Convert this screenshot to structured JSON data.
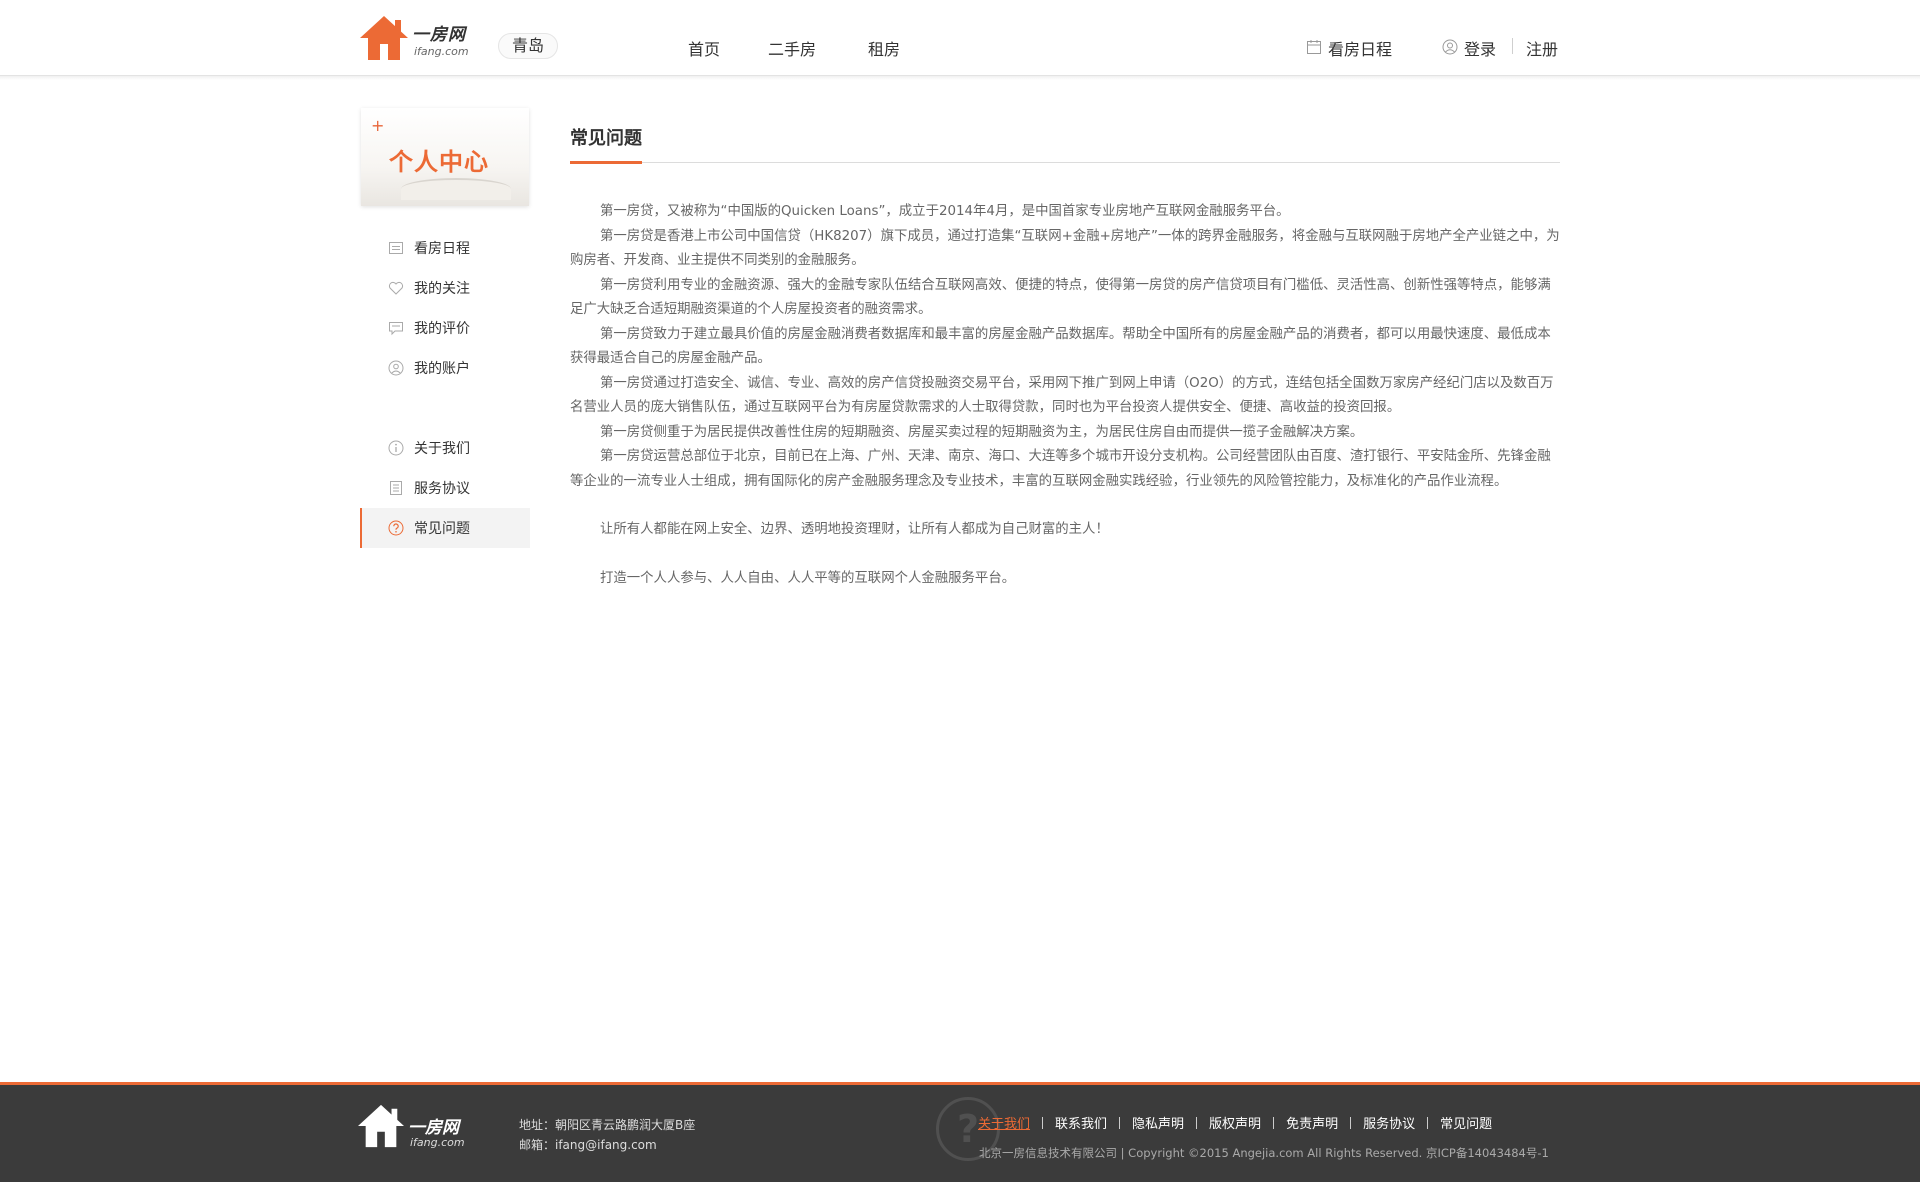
{
  "header": {
    "logo": {
      "brand": "一房网",
      "domain": "ifang.com"
    },
    "city": "青岛",
    "nav": [
      {
        "label": "首页"
      },
      {
        "label": "二手房"
      },
      {
        "label": "租房"
      }
    ],
    "schedule_label": "看房日程",
    "login_label": "登录",
    "register_label": "注册"
  },
  "sidebar": {
    "card_title": "个人中心",
    "card_plus": "+",
    "items": [
      {
        "label": "看房日程",
        "icon": "calendar-icon"
      },
      {
        "label": "我的关注",
        "icon": "heart-icon"
      },
      {
        "label": "我的评价",
        "icon": "comment-icon"
      },
      {
        "label": "我的账户",
        "icon": "user-icon"
      },
      {
        "label": "关于我们",
        "icon": "info-icon"
      },
      {
        "label": "服务协议",
        "icon": "document-icon"
      },
      {
        "label": "常见问题",
        "icon": "question-icon",
        "active": true
      }
    ]
  },
  "content": {
    "title": "常见问题",
    "paragraphs": [
      "第一房贷，又被称为“中国版的Quicken Loans”，成立于2014年4月，是中国首家专业房地产互联网金融服务平台。",
      "第一房贷是香港上市公司中国信贷（HK8207）旗下成员，通过打造集“互联网+金融+房地产”一体的跨界金融服务，将金融与互联网融于房地产全产业链之中，为购房者、开发商、业主提供不同类别的金融服务。",
      "第一房贷利用专业的金融资源、强大的金融专家队伍结合互联网高效、便捷的特点，使得第一房贷的房产信贷项目有门槛低、灵活性高、创新性强等特点，能够满足广大缺乏合适短期融资渠道的个人房屋投资者的融资需求。",
      "第一房贷致力于建立最具价值的房屋金融消费者数据库和最丰富的房屋金融产品数据库。帮助全中国所有的房屋金融产品的消费者，都可以用最快速度、最低成本获得最适合自己的房屋金融产品。",
      "第一房贷通过打造安全、诚信、专业、高效的房产信贷投融资交易平台，采用网下推广到网上申请（O2O）的方式，连结包括全国数万家房产经纪门店以及数百万名营业人员的庞大销售队伍，通过互联网平台为有房屋贷款需求的人士取得贷款，同时也为平台投资人提供安全、便捷、高收益的投资回报。",
      "第一房贷侧重于为居民提供改善性住房的短期融资、房屋买卖过程的短期融资为主，为居民住房自由而提供一揽子金融解决方案。",
      "第一房贷运营总部位于北京，目前已在上海、广州、天津、南京、海口、大连等多个城市开设分支机构。公司经营团队由百度、渣打银行、平安陆金所、先锋金融等企业的一流专业人士组成，拥有国际化的房产金融服务理念及专业技术，丰富的互联网金融实践经验，行业领先的风险管控能力，及标准化的产品作业流程。"
    ],
    "slogan1": "让所有人都能在网上安全、边界、透明地投资理财，让所有人都成为自己财富的主人！",
    "slogan2": "打造一个人人参与、人人自由、人人平等的互联网个人金融服务平台。"
  },
  "footer": {
    "logo": {
      "brand": "一房网",
      "domain": "ifang.com"
    },
    "address": "地址：朝阳区青云路鹏润大厦B座",
    "email": "邮箱：ifang@ifang.com",
    "links": [
      {
        "label": "关于我们",
        "active": true
      },
      {
        "label": "联系我们"
      },
      {
        "label": "隐私声明"
      },
      {
        "label": "版权声明"
      },
      {
        "label": "免责声明"
      },
      {
        "label": "服务协议"
      },
      {
        "label": "常见问题"
      }
    ],
    "copyright": "北京一房信息技术有限公司 | Copyright ©2015 Angejia.com All Rights Reserved. 京ICP备14043484号-1",
    "watermark_glyph": "?"
  },
  "colors": {
    "accent": "#ec6a35",
    "footer_bg": "#3b3b3b"
  }
}
